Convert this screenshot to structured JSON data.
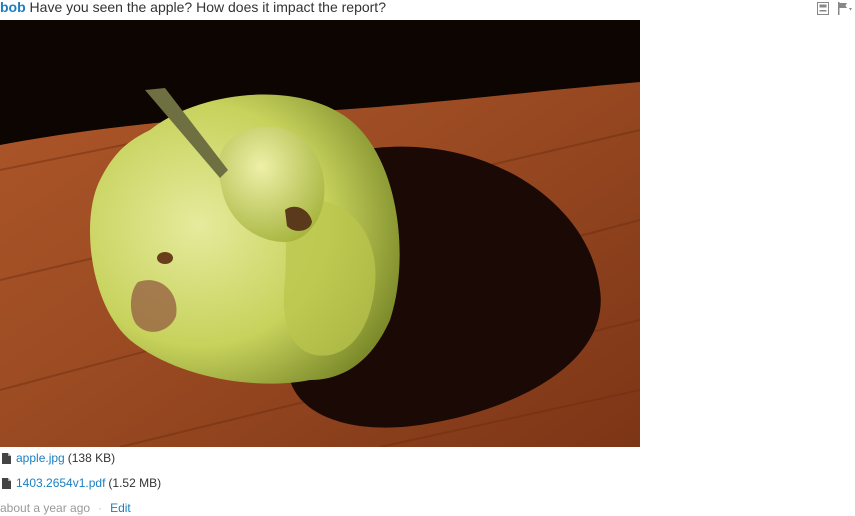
{
  "message": {
    "username": "bob",
    "text": "Have you seen the apple? How does it impact the report?",
    "actions": [
      {
        "name": "save-icon"
      },
      {
        "name": "flag-icon"
      }
    ]
  },
  "attachments": [
    {
      "filename": "apple.jpg",
      "size": "(138 KB)",
      "icon": "file-icon"
    },
    {
      "filename": "1403.2654v1.pdf",
      "size": "(1.52 MB)",
      "icon": "file-icon"
    }
  ],
  "footer": {
    "timestamp": "about a year ago",
    "separator": "·",
    "edit_label": "Edit"
  }
}
